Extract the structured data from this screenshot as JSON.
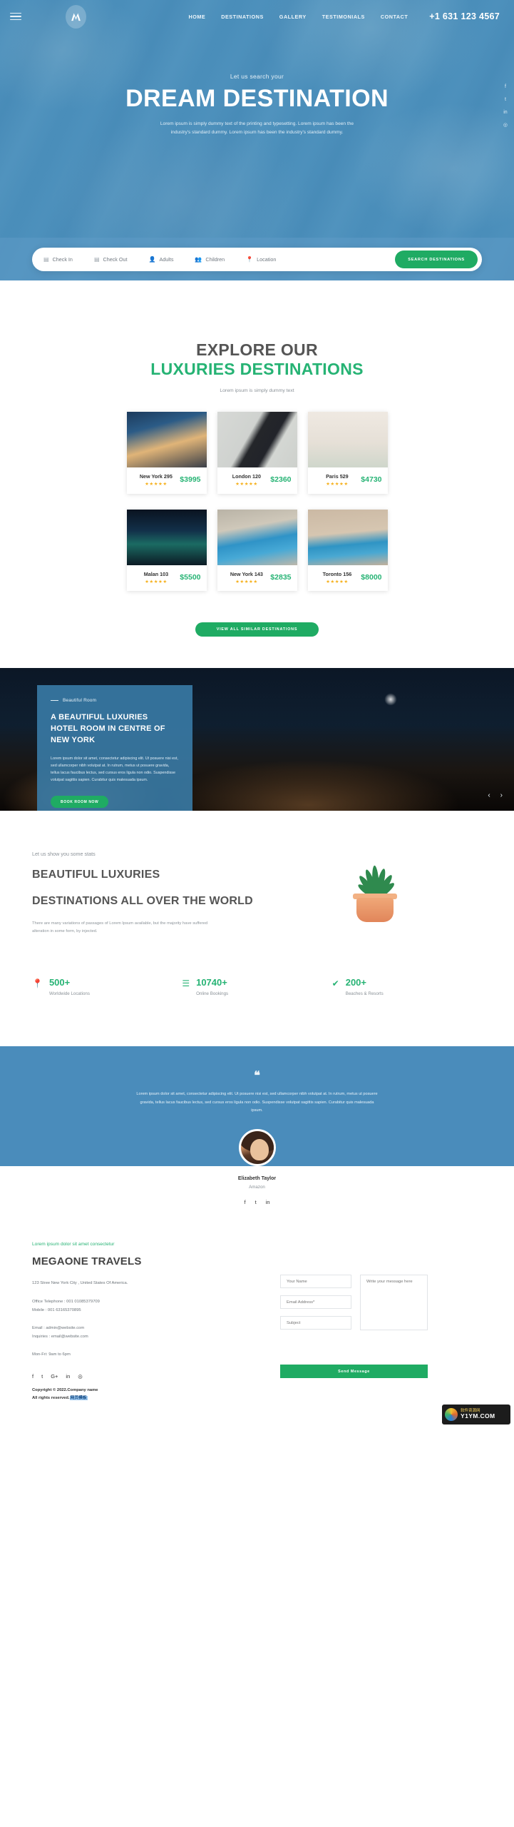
{
  "nav": {
    "menu_icon": "hamburger-icon",
    "logo_alt": "megaone-logo",
    "links": [
      "HOME",
      "DESTINATIONS",
      "GALLERY",
      "TESTIMONIALS",
      "CONTACT"
    ],
    "phone": "+1 631 123 4567"
  },
  "hero": {
    "kicker": "Let us search your",
    "title": "DREAM DESTINATION",
    "description": "Lorem ipsum is simply dummy text of the printing and typesetting. Lorem ipsum has been the industry's standard dummy. Lorem ipsum has been the industry's standard dummy.",
    "social": [
      "f",
      "t",
      "in",
      "◎"
    ],
    "search": {
      "fields": [
        {
          "icon": "calendar-icon",
          "label": "Check In",
          "glyph": "▤"
        },
        {
          "icon": "calendar-icon",
          "label": "Check Out",
          "glyph": "▤"
        },
        {
          "icon": "person-icon",
          "label": "Adults",
          "glyph": "👤"
        },
        {
          "icon": "people-icon",
          "label": "Children",
          "glyph": "👥"
        },
        {
          "icon": "location-pin-icon",
          "label": "Location",
          "glyph": "📍"
        }
      ],
      "button": "SEARCH DESTINATIONS"
    }
  },
  "explore": {
    "title_line1": "EXPLORE OUR",
    "title_line2": "LUXURIES DESTINATIONS",
    "subtitle": "Lorem ipsum is simply dummy text",
    "cards": [
      {
        "name": "New York 295",
        "price": "$3995",
        "rating": 4.5,
        "stars": "★★★★★"
      },
      {
        "name": "London 120",
        "price": "$2360",
        "rating": 4.5,
        "stars": "★★★★★"
      },
      {
        "name": "Paris 529",
        "price": "$4730",
        "rating": 4.5,
        "stars": "★★★★★"
      },
      {
        "name": "Malan 103",
        "price": "$5500",
        "rating": 4.5,
        "stars": "★★★★★"
      },
      {
        "name": "New York 143",
        "price": "$2835",
        "rating": 4.5,
        "stars": "★★★★★"
      },
      {
        "name": "Toronto 156",
        "price": "$8000",
        "rating": 4.5,
        "stars": "★★★★★"
      }
    ],
    "view_all_button": "VIEW ALL SIMILAR DESTINATIONS"
  },
  "banner": {
    "kicker": "Beautiful Room",
    "title_line1": "A BEAUTIFUL LUXURIES",
    "title_line2": "HOTEL ROOM IN CENTRE OF NEW YORK",
    "description": "Lorem ipsum dolor sit amet, consectetur adipiscing elit. Ut posuere nisi est, sed ullamcorper nibh volutpat at. In rutrum, metus ut posuere gravida, tellus lacus faucibus lectus, sed cursus eros ligula non odio. Suspendisse volutpat sagittis sapien. Curabitur quis malesuada ipsum.",
    "button": "BOOK ROOM NOW",
    "prev_arrow": "‹",
    "next_arrow": "›"
  },
  "stats": {
    "kicker": "Let us show you some stats",
    "title_line1": "BEAUTIFUL LUXURIES",
    "title_line2": "DESTINATIONS ALL OVER THE WORLD",
    "description": "There are many variations of passages of Lorem Ipsum available, but the majority have suffered alteration in some form, by injected.",
    "items": [
      {
        "icon": "location-pin-icon",
        "glyph": "📍",
        "number": "500+",
        "label": "Worldwide Locations"
      },
      {
        "icon": "list-icon",
        "glyph": "☰",
        "number": "10740+",
        "label": "Online Bookings"
      },
      {
        "icon": "check-icon",
        "glyph": "✔",
        "number": "200+",
        "label": "Beaches & Resorts"
      }
    ]
  },
  "testimonial": {
    "quote_mark": "❝",
    "text": "Lorem ipsum dolor sit amet, consectetur adipiscing elit. Ut posuere nisi est, sed ullamcorper nibh volutpat at. In rutrum, metus ut posuere gravida, tellus lacus faucibus lectus, sed cursus eros ligula non odio. Suspendisse volutpat sagittis sapien. Curabitur quis malesuada ipsum.",
    "author_name": "Elizabeth Taylor",
    "author_role": "Amazon",
    "social": [
      "f",
      "t",
      "in"
    ]
  },
  "footer": {
    "kicker": "Lorem ipsum dolor sit amet consectetur",
    "title": "MEGAONE TRAVELS",
    "address": "123 Stree New York City , United States Of America.",
    "office_phone": "Office Telephone : 001 01085379709",
    "mobile_phone": "Mobile : 001 63165370895",
    "email": "Email : admin@website.com",
    "inquiries": "Inquiries : email@website.com",
    "hours": "Mon-Fri: 9am to 6pm",
    "social": [
      "f",
      "t",
      "G+",
      "in",
      "◎"
    ],
    "copyright_line1": "Copyright © 2022.Company name",
    "copyright_line2_a": "All rights reserved.",
    "copyright_line2_b": "网页模板",
    "form": {
      "name_placeholder": "Your Name",
      "email_placeholder": "Email Address*",
      "subject_placeholder": "Subject",
      "message_placeholder": "Write your message here",
      "send_button": "Send Message"
    }
  },
  "watermark": {
    "top": "软件资源网",
    "bottom": "Y1YM.COM"
  },
  "colors": {
    "accent_green": "#1fab63",
    "title_green": "#26b374",
    "hero_blue": "#4a8cbb",
    "star_gold": "#f6b11e"
  }
}
